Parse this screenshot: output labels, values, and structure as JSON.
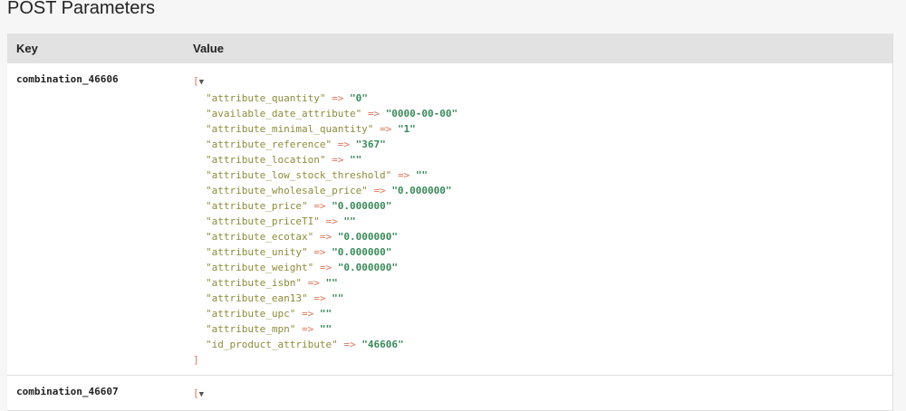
{
  "title": "POST Parameters",
  "headers": {
    "key": "Key",
    "value": "Value"
  },
  "rows": [
    {
      "key": "combination_46606",
      "open": "[",
      "toggle": "▼",
      "close": "]",
      "arrow": "=>",
      "items": [
        {
          "k": "\"attribute_quantity\"",
          "v": "\"0\""
        },
        {
          "k": "\"available_date_attribute\"",
          "v": "\"0000-00-00\""
        },
        {
          "k": "\"attribute_minimal_quantity\"",
          "v": "\"1\""
        },
        {
          "k": "\"attribute_reference\"",
          "v": "\"367\""
        },
        {
          "k": "\"attribute_location\"",
          "v": "\"\""
        },
        {
          "k": "\"attribute_low_stock_threshold\"",
          "v": "\"\""
        },
        {
          "k": "\"attribute_wholesale_price\"",
          "v": "\"0.000000\""
        },
        {
          "k": "\"attribute_price\"",
          "v": "\"0.000000\""
        },
        {
          "k": "\"attribute_priceTI\"",
          "v": "\"\""
        },
        {
          "k": "\"attribute_ecotax\"",
          "v": "\"0.000000\""
        },
        {
          "k": "\"attribute_unity\"",
          "v": "\"0.000000\""
        },
        {
          "k": "\"attribute_weight\"",
          "v": "\"0.000000\""
        },
        {
          "k": "\"attribute_isbn\"",
          "v": "\"\""
        },
        {
          "k": "\"attribute_ean13\"",
          "v": "\"\""
        },
        {
          "k": "\"attribute_upc\"",
          "v": "\"\""
        },
        {
          "k": "\"attribute_mpn\"",
          "v": "\"\""
        },
        {
          "k": "\"id_product_attribute\"",
          "v": "\"46606\""
        }
      ]
    },
    {
      "key": "combination_46607",
      "open": "[",
      "toggle": "▼"
    }
  ]
}
